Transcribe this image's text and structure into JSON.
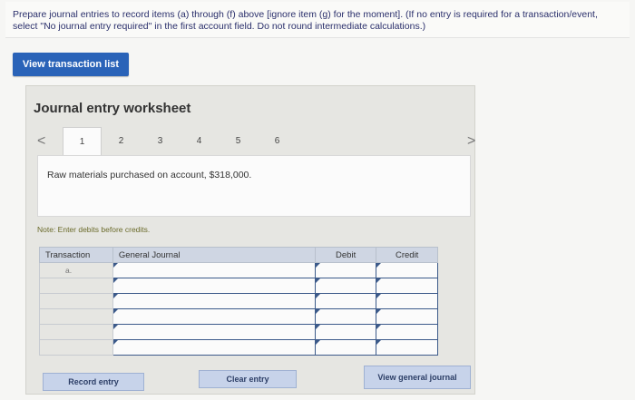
{
  "instructions": "Prepare journal entries to record items (a) through (f) above [ignore item (g) for the moment]. (If no entry is required for a transaction/event, select \"No journal entry required\" in the first account field. Do not round intermediate calculations.)",
  "view_transaction_list": "View transaction list",
  "worksheet": {
    "title": "Journal entry worksheet",
    "tabs": [
      "1",
      "2",
      "3",
      "4",
      "5",
      "6"
    ],
    "active_tab": "1",
    "prev_glyph": "<",
    "next_glyph": ">",
    "description": "Raw materials purchased on account, $318,000.",
    "note": "Note: Enter debits before credits.",
    "table": {
      "headers": [
        "Transaction",
        "General Journal",
        "Debit",
        "Credit"
      ],
      "rows": [
        {
          "transaction": "a."
        },
        {
          "transaction": ""
        },
        {
          "transaction": ""
        },
        {
          "transaction": ""
        },
        {
          "transaction": ""
        },
        {
          "transaction": ""
        }
      ]
    },
    "buttons": {
      "record": "Record entry",
      "clear": "Clear entry",
      "view_journal": "View general journal"
    }
  }
}
